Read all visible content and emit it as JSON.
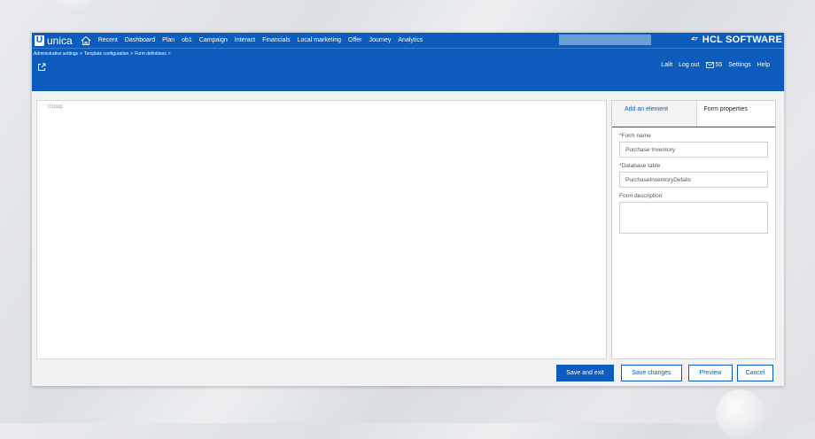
{
  "brand": {
    "logo_letter": "U",
    "name": "unica"
  },
  "nav": {
    "items": [
      "Recent",
      "Dashboard",
      "Plan",
      "ob1",
      "Campaign",
      "Interact",
      "Financials",
      "Local marketing",
      "Offer",
      "Journey",
      "Analytics"
    ]
  },
  "hcl_logo": {
    "mark": "⁴⁷",
    "text": "HCL SOFTWARE"
  },
  "breadcrumb": [
    "Administrative settings",
    "Template configuration",
    "Form definitions"
  ],
  "user_links": {
    "user": "Lalit",
    "logout": "Log out",
    "messages": "55",
    "settings": "Settings",
    "help": "Help"
  },
  "canvas": {
    "group_label": "Group"
  },
  "panel": {
    "tabs": {
      "add_element": "Add an element",
      "form_properties": "Form properties"
    },
    "form_name": {
      "label": "Form name",
      "value": "Purchase Inventory"
    },
    "database_table": {
      "label": "Database table",
      "value": "PurchaseInventoryDetails"
    },
    "form_description": {
      "label": "Form description",
      "value": ""
    }
  },
  "buttons": {
    "save_exit": "Save and exit",
    "save_changes": "Save changes",
    "preview": "Preview",
    "cancel": "Cancel"
  },
  "colors": {
    "brand_blue": "#0b5cbd",
    "required": "#d93025"
  },
  "icons": [
    "home-icon",
    "export-icon",
    "mail-icon"
  ]
}
